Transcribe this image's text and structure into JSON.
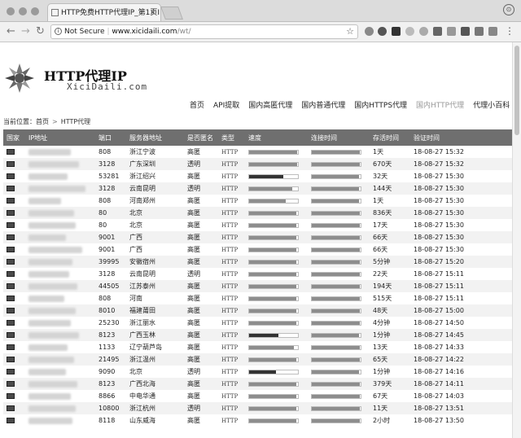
{
  "browser": {
    "tab_title": "HTTP免费HTTP代理IP_第1页I",
    "tab_close": "×",
    "security_label": "Not Secure",
    "url_domain": "www.xicidaili.com",
    "url_path": "/wt/"
  },
  "site": {
    "brand": "HTTP代理IP",
    "brand_sub": "XiciDaili.com",
    "nav": [
      "首页",
      "API提取",
      "国内高匿代理",
      "国内普通代理",
      "国内HTTPS代理",
      "国内HTTP代理",
      "代理小百科"
    ],
    "active_nav_index": 5,
    "breadcrumb": {
      "prefix": "当前位置：",
      "home": "首页",
      "separator": ">",
      "current": "HTTP代理"
    }
  },
  "table": {
    "headers": [
      "国家",
      "IP地址",
      "端口",
      "服务器地址",
      "是否匿名",
      "类型",
      "速度",
      "连接时间",
      "存活时间",
      "验证时间"
    ],
    "rows": [
      {
        "port": "808",
        "location": "浙江宁波",
        "anonymity": "高匿",
        "type": "HTTP",
        "speed": 0.98,
        "speed_dark": false,
        "conn": 0.98,
        "alive": "1天",
        "verified": "18-08-27 15:32"
      },
      {
        "port": "3128",
        "location": "广东深圳",
        "anonymity": "透明",
        "type": "HTTP",
        "speed": 0.98,
        "speed_dark": false,
        "conn": 0.98,
        "alive": "670天",
        "verified": "18-08-27 15:32"
      },
      {
        "port": "53281",
        "location": "浙江绍兴",
        "anonymity": "高匿",
        "type": "HTTP",
        "speed": 0.7,
        "speed_dark": true,
        "conn": 0.96,
        "alive": "32天",
        "verified": "18-08-27 15:30"
      },
      {
        "port": "3128",
        "location": "云南昆明",
        "anonymity": "透明",
        "type": "HTTP",
        "speed": 0.88,
        "speed_dark": false,
        "conn": 0.97,
        "alive": "144天",
        "verified": "18-08-27 15:30"
      },
      {
        "port": "808",
        "location": "河南郑州",
        "anonymity": "高匿",
        "type": "HTTP",
        "speed": 0.75,
        "speed_dark": false,
        "conn": 0.97,
        "alive": "1天",
        "verified": "18-08-27 15:30"
      },
      {
        "port": "80",
        "location": "北京",
        "anonymity": "高匿",
        "type": "HTTP",
        "speed": 0.96,
        "speed_dark": false,
        "conn": 0.98,
        "alive": "836天",
        "verified": "18-08-27 15:30"
      },
      {
        "port": "80",
        "location": "北京",
        "anonymity": "高匿",
        "type": "HTTP",
        "speed": 0.97,
        "speed_dark": false,
        "conn": 0.98,
        "alive": "17天",
        "verified": "18-08-27 15:30"
      },
      {
        "port": "9001",
        "location": "广西",
        "anonymity": "高匿",
        "type": "HTTP",
        "speed": 0.97,
        "speed_dark": false,
        "conn": 0.98,
        "alive": "66天",
        "verified": "18-08-27 15:30"
      },
      {
        "port": "9001",
        "location": "广西",
        "anonymity": "高匿",
        "type": "HTTP",
        "speed": 0.97,
        "speed_dark": false,
        "conn": 0.98,
        "alive": "66天",
        "verified": "18-08-27 15:30"
      },
      {
        "port": "39995",
        "location": "安徽宿州",
        "anonymity": "高匿",
        "type": "HTTP",
        "speed": 0.97,
        "speed_dark": false,
        "conn": 0.98,
        "alive": "5分钟",
        "verified": "18-08-27 15:20"
      },
      {
        "port": "3128",
        "location": "云南昆明",
        "anonymity": "透明",
        "type": "HTTP",
        "speed": 0.96,
        "speed_dark": false,
        "conn": 0.98,
        "alive": "22天",
        "verified": "18-08-27 15:11"
      },
      {
        "port": "44505",
        "location": "江苏泰州",
        "anonymity": "高匿",
        "type": "HTTP",
        "speed": 0.97,
        "speed_dark": false,
        "conn": 0.98,
        "alive": "194天",
        "verified": "18-08-27 15:11"
      },
      {
        "port": "808",
        "location": "河南",
        "anonymity": "高匿",
        "type": "HTTP",
        "speed": 0.97,
        "speed_dark": false,
        "conn": 0.98,
        "alive": "515天",
        "verified": "18-08-27 15:11"
      },
      {
        "port": "8010",
        "location": "福建莆田",
        "anonymity": "高匿",
        "type": "HTTP",
        "speed": 0.97,
        "speed_dark": false,
        "conn": 0.98,
        "alive": "48天",
        "verified": "18-08-27 15:00"
      },
      {
        "port": "25230",
        "location": "浙江丽水",
        "anonymity": "高匿",
        "type": "HTTP",
        "speed": 0.97,
        "speed_dark": false,
        "conn": 0.98,
        "alive": "4分钟",
        "verified": "18-08-27 14:50"
      },
      {
        "port": "8123",
        "location": "广西玉林",
        "anonymity": "高匿",
        "type": "HTTP",
        "speed": 0.6,
        "speed_dark": true,
        "conn": 0.97,
        "alive": "1分钟",
        "verified": "18-08-27 14:45"
      },
      {
        "port": "1133",
        "location": "辽宁葫芦岛",
        "anonymity": "高匿",
        "type": "HTTP",
        "speed": 0.92,
        "speed_dark": false,
        "conn": 0.98,
        "alive": "13天",
        "verified": "18-08-27 14:33"
      },
      {
        "port": "21495",
        "location": "浙江温州",
        "anonymity": "高匿",
        "type": "HTTP",
        "speed": 0.96,
        "speed_dark": false,
        "conn": 0.98,
        "alive": "65天",
        "verified": "18-08-27 14:22"
      },
      {
        "port": "9090",
        "location": "北京",
        "anonymity": "透明",
        "type": "HTTP",
        "speed": 0.55,
        "speed_dark": true,
        "conn": 0.97,
        "alive": "1分钟",
        "verified": "18-08-27 14:16"
      },
      {
        "port": "8123",
        "location": "广西北海",
        "anonymity": "高匿",
        "type": "HTTP",
        "speed": 0.97,
        "speed_dark": false,
        "conn": 0.98,
        "alive": "379天",
        "verified": "18-08-27 14:11"
      },
      {
        "port": "8866",
        "location": "中电华通",
        "anonymity": "高匿",
        "type": "HTTP",
        "speed": 0.97,
        "speed_dark": false,
        "conn": 0.98,
        "alive": "67天",
        "verified": "18-08-27 14:03"
      },
      {
        "port": "10800",
        "location": "浙江杭州",
        "anonymity": "透明",
        "type": "HTTP",
        "speed": 0.96,
        "speed_dark": false,
        "conn": 0.98,
        "alive": "11天",
        "verified": "18-08-27 13:51"
      },
      {
        "port": "8118",
        "location": "山东威海",
        "anonymity": "高匿",
        "type": "HTTP",
        "speed": 0.97,
        "speed_dark": false,
        "conn": 0.98,
        "alive": "2小时",
        "verified": "18-08-27 13:50"
      }
    ]
  }
}
